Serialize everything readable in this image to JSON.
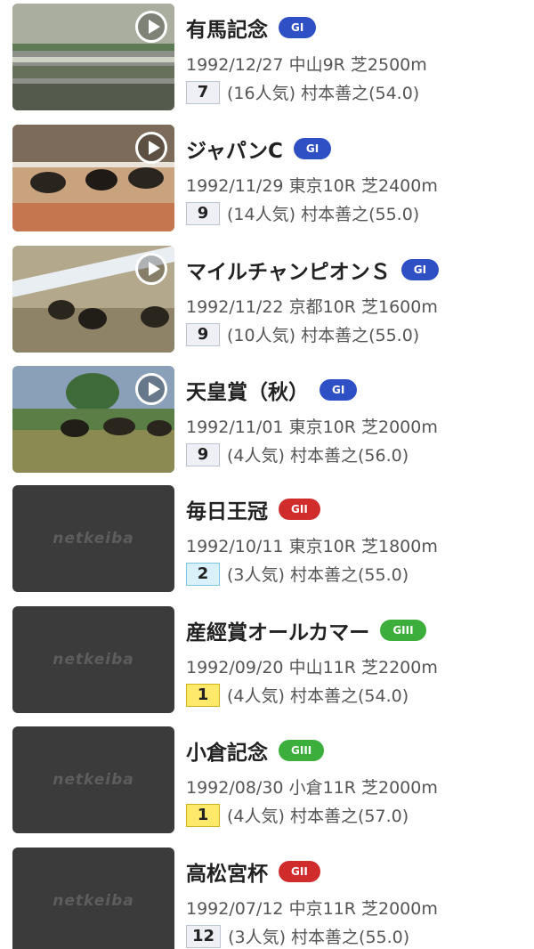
{
  "colors": {
    "G1": "#2f4fc4",
    "G2": "#d02c2c",
    "G3": "#3cae3c"
  },
  "placeholder_brand": "netkeiba",
  "races": [
    {
      "name": "有馬記念",
      "grade": "GI",
      "grade_class": "G1",
      "date": "1992/12/27",
      "venue_race": "中山9R",
      "surface": "芝2500m",
      "finish": "7",
      "finish_style": "default",
      "popularity": "(16人気)",
      "jockey": "村本善之",
      "weight": "(54.0)",
      "has_video": true,
      "thumb_icon": "play-icon"
    },
    {
      "name": "ジャパンC",
      "grade": "GI",
      "grade_class": "G1",
      "date": "1992/11/29",
      "venue_race": "東京10R",
      "surface": "芝2400m",
      "finish": "9",
      "finish_style": "default",
      "popularity": "(14人気)",
      "jockey": "村本善之",
      "weight": "(55.0)",
      "has_video": true,
      "thumb_icon": "play-icon"
    },
    {
      "name": "マイルチャンピオンＳ",
      "grade": "GI",
      "grade_class": "G1",
      "date": "1992/11/22",
      "venue_race": "京都10R",
      "surface": "芝1600m",
      "finish": "9",
      "finish_style": "default",
      "popularity": "(10人気)",
      "jockey": "村本善之",
      "weight": "(55.0)",
      "has_video": true,
      "thumb_icon": "play-icon"
    },
    {
      "name": "天皇賞（秋）",
      "grade": "GI",
      "grade_class": "G1",
      "date": "1992/11/01",
      "venue_race": "東京10R",
      "surface": "芝2000m",
      "finish": "9",
      "finish_style": "default",
      "popularity": "(4人気)",
      "jockey": "村本善之",
      "weight": "(56.0)",
      "has_video": true,
      "thumb_icon": "play-icon"
    },
    {
      "name": "毎日王冠",
      "grade": "GII",
      "grade_class": "G2",
      "date": "1992/10/11",
      "venue_race": "東京10R",
      "surface": "芝1800m",
      "finish": "2",
      "finish_style": "second",
      "popularity": "(3人気)",
      "jockey": "村本善之",
      "weight": "(55.0)",
      "has_video": false
    },
    {
      "name": "産經賞オールカマー",
      "grade": "GIII",
      "grade_class": "G3",
      "date": "1992/09/20",
      "venue_race": "中山11R",
      "surface": "芝2200m",
      "finish": "1",
      "finish_style": "first",
      "popularity": "(4人気)",
      "jockey": "村本善之",
      "weight": "(54.0)",
      "has_video": false
    },
    {
      "name": "小倉記念",
      "grade": "GIII",
      "grade_class": "G3",
      "date": "1992/08/30",
      "venue_race": "小倉11R",
      "surface": "芝2000m",
      "finish": "1",
      "finish_style": "first",
      "popularity": "(4人気)",
      "jockey": "村本善之",
      "weight": "(57.0)",
      "has_video": false
    },
    {
      "name": "高松宮杯",
      "grade": "GII",
      "grade_class": "G2",
      "date": "1992/07/12",
      "venue_race": "中京11R",
      "surface": "芝2000m",
      "finish": "12",
      "finish_style": "default",
      "popularity": "(3人気)",
      "jockey": "村本善之",
      "weight": "(55.0)",
      "has_video": false
    }
  ]
}
